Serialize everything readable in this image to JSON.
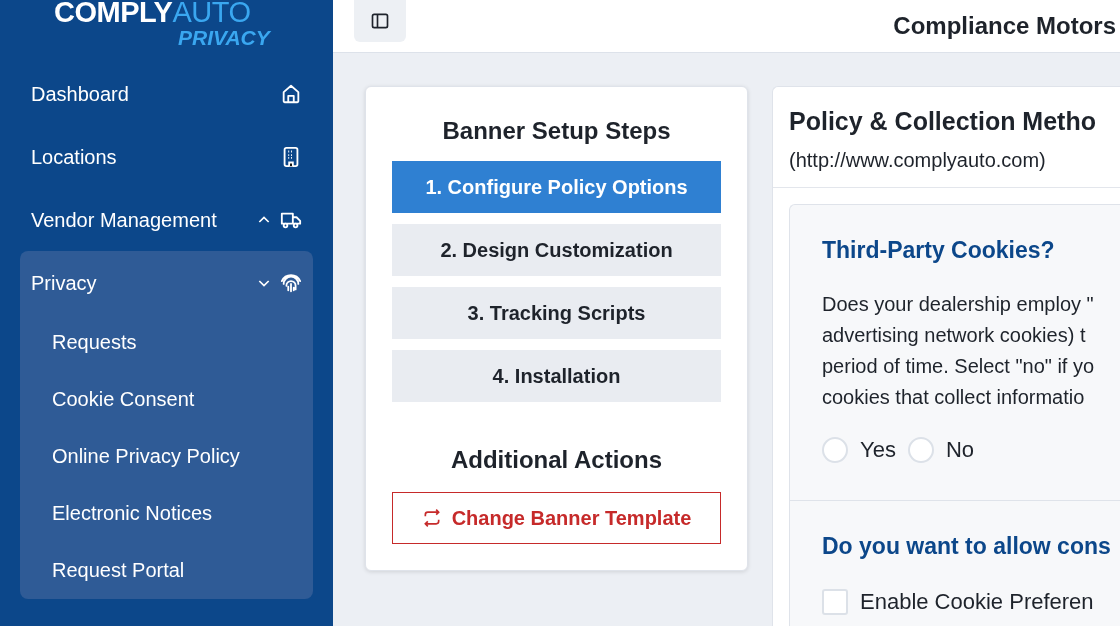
{
  "logo": {
    "primary": "COMPLY",
    "accent": "AUTO",
    "tagline": "PRIVACY"
  },
  "sidebar": {
    "items": [
      {
        "label": "Dashboard"
      },
      {
        "label": "Locations"
      },
      {
        "label": "Vendor Management",
        "expanded": false
      },
      {
        "label": "Privacy",
        "expanded": true,
        "children": [
          {
            "label": "Requests"
          },
          {
            "label": "Cookie Consent"
          },
          {
            "label": "Online Privacy Policy"
          },
          {
            "label": "Electronic Notices"
          },
          {
            "label": "Request Portal"
          }
        ]
      }
    ]
  },
  "header": {
    "title": "Compliance Motors"
  },
  "steps_card": {
    "title": "Banner Setup Steps",
    "steps": [
      {
        "label": "1. Configure Policy Options",
        "selected": true
      },
      {
        "label": "2. Design Customization",
        "selected": false
      },
      {
        "label": "3. Tracking Scripts",
        "selected": false
      },
      {
        "label": "4. Installation",
        "selected": false
      }
    ],
    "actions_title": "Additional Actions",
    "action_button": "Change Banner Template"
  },
  "policy_card": {
    "title": "Policy & Collection Metho",
    "url": "(http://www.complyauto.com)",
    "sections": [
      {
        "kind": "radio",
        "title": "Third-Party Cookies?",
        "lines": [
          "Does your dealership employ \"",
          "advertising network cookies) t",
          "period of time. Select \"no\" if yo",
          "cookies that collect informatio"
        ],
        "options": [
          {
            "label": "Yes",
            "checked": false
          },
          {
            "label": "No",
            "checked": false
          }
        ]
      },
      {
        "kind": "checkbox",
        "title": "Do you want to allow cons",
        "options": [
          {
            "label": "Enable Cookie Preferen",
            "checked": false
          }
        ]
      }
    ]
  }
}
